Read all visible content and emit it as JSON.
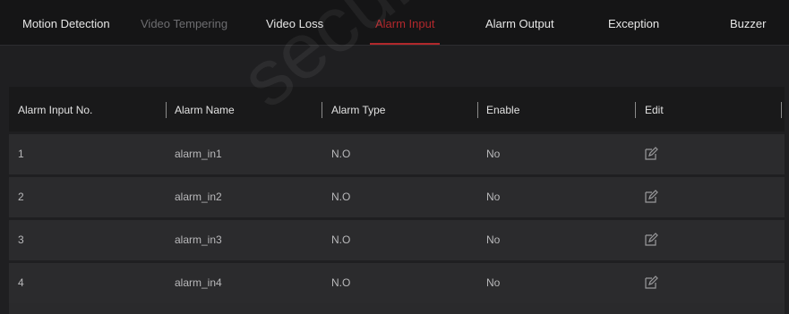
{
  "tabs": [
    {
      "label": "Motion Detection",
      "state": "normal"
    },
    {
      "label": "Video Tempering",
      "state": "disabled"
    },
    {
      "label": "Video Loss",
      "state": "normal"
    },
    {
      "label": "Alarm Input",
      "state": "active"
    },
    {
      "label": "Alarm Output",
      "state": "normal"
    },
    {
      "label": "Exception",
      "state": "normal"
    },
    {
      "label": "Buzzer",
      "state": "normal"
    }
  ],
  "table": {
    "headers": {
      "no": "Alarm Input No.",
      "name": "Alarm Name",
      "type": "Alarm Type",
      "enable": "Enable",
      "edit": "Edit"
    },
    "rows": [
      {
        "no": "1",
        "name": "alarm_in1",
        "type": "N.O",
        "enable": "No",
        "edit_icon": "edit-icon"
      },
      {
        "no": "2",
        "name": "alarm_in2",
        "type": "N.O",
        "enable": "No",
        "edit_icon": "edit-icon"
      },
      {
        "no": "3",
        "name": "alarm_in3",
        "type": "N.O",
        "enable": "No",
        "edit_icon": "edit-icon"
      },
      {
        "no": "4",
        "name": "alarm_in4",
        "type": "N.O",
        "enable": "No",
        "edit_icon": "edit-icon"
      }
    ]
  },
  "watermark": "security.",
  "colors": {
    "active_tab": "#b1282c",
    "background": "#1f1f21",
    "header_bg": "#19191a",
    "row_bg": "#2b2b2d"
  }
}
